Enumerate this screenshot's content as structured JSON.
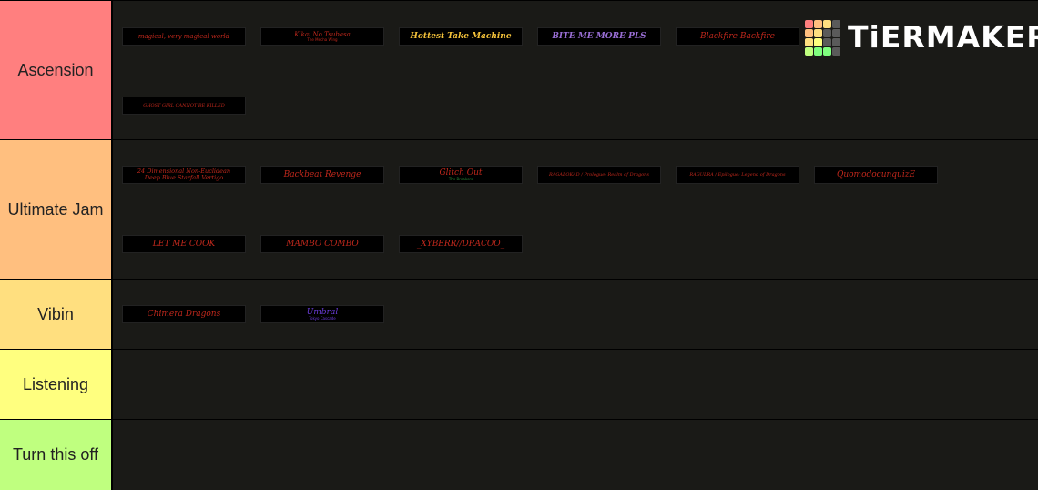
{
  "logo": {
    "text": "TiERMAKER",
    "grid_colors": [
      "#ff7f7f",
      "#ffbf7f",
      "#ffdf80",
      "#5a5a5a",
      "#ffbf7f",
      "#ffdf80",
      "#5a5a5a",
      "#5a5a5a",
      "#ffdf80",
      "#ffff7f",
      "#5a5a5a",
      "#5a5a5a",
      "#bfff7f",
      "#7fff7f",
      "#7fff7f",
      "#5a5a5a"
    ]
  },
  "tiers": [
    {
      "label": "Ascension",
      "color": "#ff7f7f",
      "items": [
        {
          "title": "magical, very magical world",
          "sub": "",
          "color": "#c0281c"
        },
        {
          "title": "Kikai No Tsubasa",
          "sub": "The Mecha Wing",
          "color": "#c0281c"
        },
        {
          "title": "Hottest Take Machine",
          "sub": "",
          "color": "#f4c23a"
        },
        {
          "title": "BITE ME MORE PLS",
          "sub": "",
          "color": "#9a6fd6"
        },
        {
          "title": "Blackfire Backfire",
          "sub": "",
          "color": "#c0281c"
        },
        {
          "title": "GHOST GIRL CANNOT BE KILLED",
          "sub": "",
          "color": "#c0281c"
        }
      ]
    },
    {
      "label": "Ultimate Jam",
      "color": "#ffbf7f",
      "items": [
        {
          "title": "24 Dimensional Non-Euclidean",
          "sub": "Deep Blue Starfall Vertigo",
          "color": "#c0281c"
        },
        {
          "title": "Backbeat Revenge",
          "sub": "",
          "color": "#c0281c"
        },
        {
          "title": "Glitch Out",
          "sub": "The Breakers",
          "color": "#c0281c"
        },
        {
          "title": "RAGALOKAD / Prologue: Realm of Dragons",
          "sub": "",
          "color": "#c0281c"
        },
        {
          "title": "RAGULRA / Epilogue: Legend of Dragons",
          "sub": "",
          "color": "#c0281c"
        },
        {
          "title": "QuomodocunquizE",
          "sub": "",
          "color": "#c0281c"
        },
        {
          "title": "LET ME COOK",
          "sub": "",
          "color": "#c0281c"
        },
        {
          "title": "MAMBO COMBO",
          "sub": "",
          "color": "#c0281c"
        },
        {
          "title": "_XYBERR//DRACOO_",
          "sub": "",
          "color": "#c0281c"
        }
      ]
    },
    {
      "label": "Vibin",
      "color": "#ffdf7f",
      "items": [
        {
          "title": "Chimera Dragons",
          "sub": "",
          "color": "#c0281c"
        },
        {
          "title": "Umbral",
          "sub": "Tokyo Cascade",
          "color": "#6a3cd8"
        }
      ]
    },
    {
      "label": "Listening",
      "color": "#ffff7f",
      "items": []
    },
    {
      "label": "Turn this off",
      "color": "#bfff7f",
      "items": []
    }
  ]
}
